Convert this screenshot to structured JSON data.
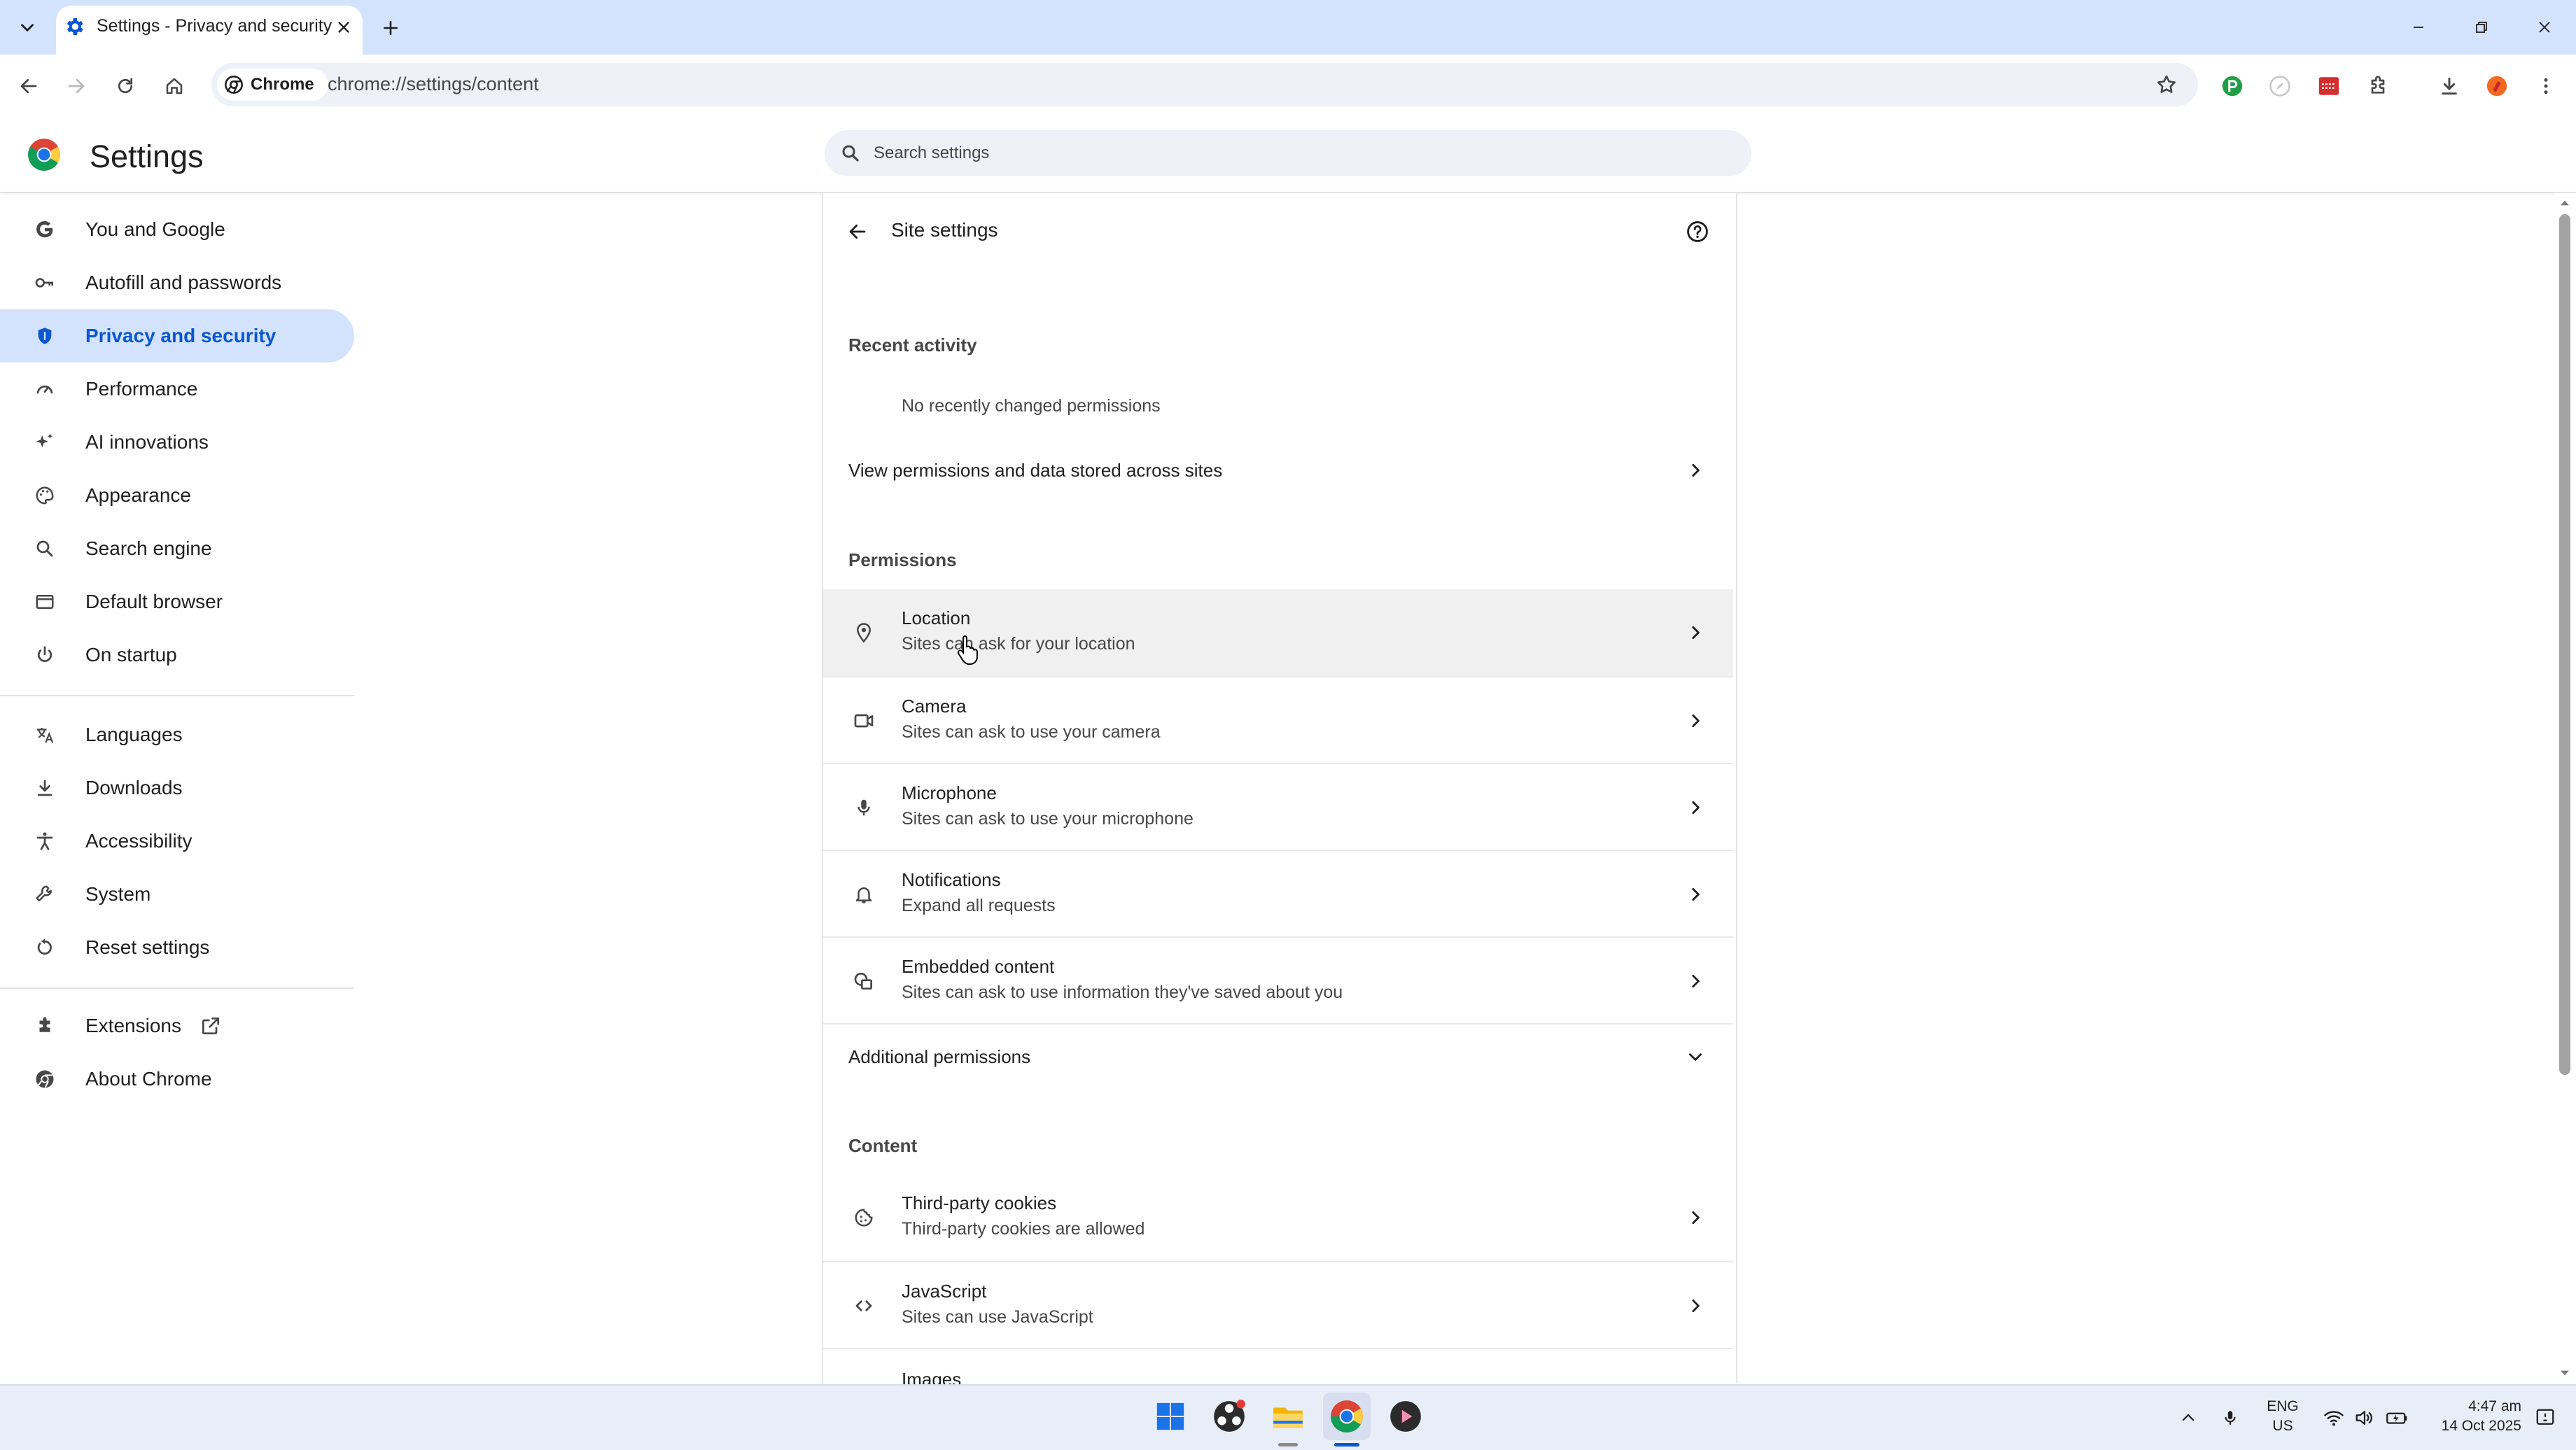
{
  "tab": {
    "title": "Settings - Privacy and security",
    "favicon": "gear-icon"
  },
  "window": {
    "minimize": "minimize-icon",
    "restore": "restore-icon",
    "close": "close-icon"
  },
  "toolbar": {
    "chip_label": "Chrome",
    "url": "chrome://settings/content"
  },
  "header": {
    "title": "Settings",
    "search_placeholder": "Search settings"
  },
  "sidebar": {
    "items": [
      {
        "label": "You and Google",
        "icon": "google-g-icon"
      },
      {
        "label": "Autofill and passwords",
        "icon": "key-icon"
      },
      {
        "label": "Privacy and security",
        "icon": "shield-icon",
        "selected": true
      },
      {
        "label": "Performance",
        "icon": "speedometer-icon"
      },
      {
        "label": "AI innovations",
        "icon": "sparkle-icon"
      },
      {
        "label": "Appearance",
        "icon": "palette-icon"
      },
      {
        "label": "Search engine",
        "icon": "search-icon"
      },
      {
        "label": "Default browser",
        "icon": "browser-window-icon"
      },
      {
        "label": "On startup",
        "icon": "power-icon"
      },
      {
        "label": "Languages",
        "icon": "translate-icon"
      },
      {
        "label": "Downloads",
        "icon": "download-icon"
      },
      {
        "label": "Accessibility",
        "icon": "accessibility-icon"
      },
      {
        "label": "System",
        "icon": "wrench-icon"
      },
      {
        "label": "Reset settings",
        "icon": "reset-icon"
      },
      {
        "label": "Extensions",
        "icon": "puzzle-icon"
      },
      {
        "label": "About Chrome",
        "icon": "chrome-icon"
      }
    ]
  },
  "main": {
    "title": "Site settings",
    "recent_activity": {
      "heading": "Recent activity",
      "empty_text": "No recently changed permissions",
      "view_all": "View permissions and data stored across sites"
    },
    "permissions": {
      "heading": "Permissions",
      "rows": [
        {
          "title": "Location",
          "subtitle": "Sites can ask for your location",
          "icon": "location-pin-icon"
        },
        {
          "title": "Camera",
          "subtitle": "Sites can ask to use your camera",
          "icon": "camera-icon"
        },
        {
          "title": "Microphone",
          "subtitle": "Sites can ask to use your microphone",
          "icon": "microphone-icon"
        },
        {
          "title": "Notifications",
          "subtitle": "Expand all requests",
          "icon": "bell-icon"
        },
        {
          "title": "Embedded content",
          "subtitle": "Sites can ask to use information they've saved about you",
          "icon": "embedded-content-icon"
        }
      ],
      "additional": "Additional permissions"
    },
    "content": {
      "heading": "Content",
      "rows": [
        {
          "title": "Third-party cookies",
          "subtitle": "Third-party cookies are allowed",
          "icon": "cookie-icon"
        },
        {
          "title": "JavaScript",
          "subtitle": "Sites can use JavaScript",
          "icon": "code-icon"
        },
        {
          "title": "Images",
          "subtitle": "",
          "icon": "image-icon"
        }
      ]
    }
  },
  "taskbar": {
    "apps": [
      "windows-start-icon",
      "obs-icon",
      "file-explorer-icon",
      "chrome-icon",
      "media-player-icon"
    ],
    "lang_line1": "ENG",
    "lang_line2": "US",
    "time": "4:47 am",
    "date": "14 Oct 2025"
  },
  "colors": {
    "accent": "#0b57d0",
    "tabstrip": "#d3e3fd",
    "selected_nav": "#d3e3fd",
    "row_hover": "#f0f0f0"
  }
}
